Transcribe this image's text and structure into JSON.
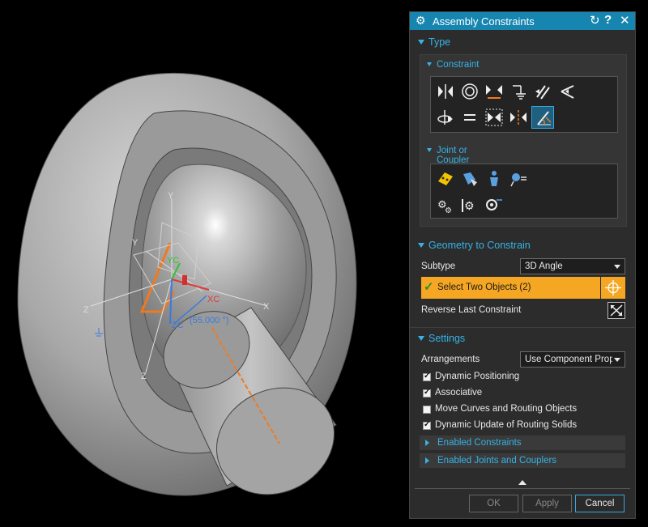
{
  "viewport": {
    "labels": {
      "y_top": "Y",
      "y_left": "Y",
      "yc": "YC",
      "xc": "XC",
      "zc": "ZC",
      "x_right": "X",
      "z_left": "Z",
      "z_bottom": "Z",
      "angle": "(55.000 °)"
    }
  },
  "dialog": {
    "title": "Assembly Constraints",
    "type_section": {
      "label": "Type",
      "constraint_label": "Constraint",
      "constraint_icons_row1": [
        "touch-align-icon",
        "concentric-icon",
        "distance-icon",
        "fix-icon",
        "parallel-icon",
        "perpendicular-icon"
      ],
      "constraint_icons_row2": [
        "align-lock-icon",
        "equal-icon",
        "fit-icon",
        "center-icon",
        "angle-icon"
      ],
      "selected_constraint": "angle-icon",
      "joint_label": "Joint or Coupler",
      "joint_icons_row1": [
        "joint-yellow-icon",
        "joint-hinge-icon",
        "joint-figure-icon",
        "joint-pin-icon"
      ],
      "joint_icons_row2": [
        "gear-coupler-icon",
        "rack-coupler-icon",
        "cable-coupler-icon"
      ]
    },
    "geometry_section": {
      "label": "Geometry to Constrain",
      "subtype_label": "Subtype",
      "subtype_value": "3D Angle",
      "select_label": "Select Two Objects (2)",
      "reverse_label": "Reverse Last Constraint"
    },
    "settings_section": {
      "label": "Settings",
      "arrangements_label": "Arrangements",
      "arrangements_value": "Use Component Properties",
      "checkboxes": [
        {
          "label": "Dynamic Positioning",
          "checked": true
        },
        {
          "label": "Associative",
          "checked": true
        },
        {
          "label": "Move Curves and Routing Objects",
          "checked": false
        },
        {
          "label": "Dynamic Update of Routing Solids",
          "checked": true
        }
      ],
      "enabled_constraints": "Enabled Constraints",
      "enabled_joints": "Enabled Joints and Couplers"
    },
    "buttons": {
      "ok": "OK",
      "apply": "Apply",
      "cancel": "Cancel"
    },
    "colors": {
      "accent": "#35b3e6",
      "titlebar": "#1686b1",
      "selection": "#f5a623"
    }
  }
}
